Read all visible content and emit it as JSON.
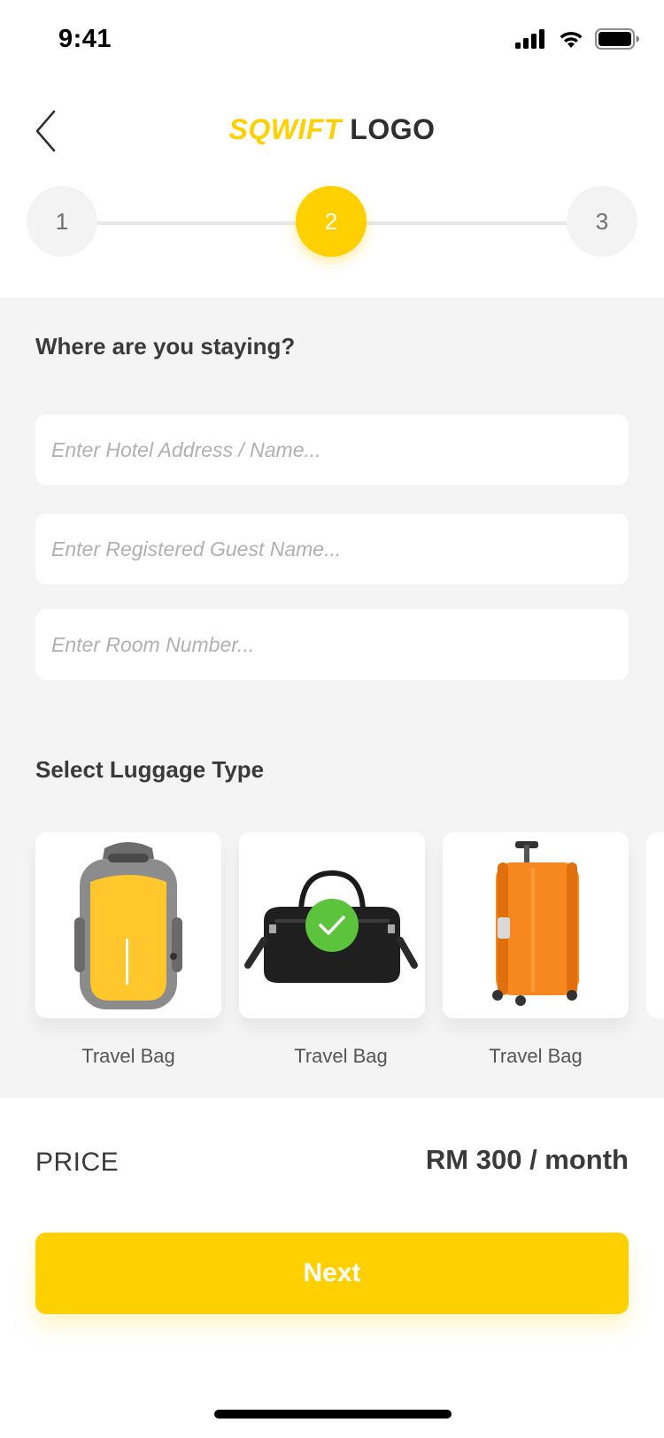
{
  "status_bar": {
    "time": "9:41"
  },
  "header": {
    "logo_part1": "SQWIFT",
    "logo_part2": "LOGO"
  },
  "stepper": {
    "steps": [
      "1",
      "2",
      "3"
    ],
    "active_index": 1
  },
  "stay_section": {
    "title": "Where are you staying?",
    "hotel_placeholder": "Enter Hotel Address / Name...",
    "guest_placeholder": "Enter Registered Guest Name...",
    "room_placeholder": "Enter Room Number..."
  },
  "luggage_section": {
    "title": "Select Luggage Type",
    "items": [
      {
        "label": "Travel Bag",
        "icon": "backpack-icon",
        "selected": false
      },
      {
        "label": "Travel Bag",
        "icon": "duffel-bag-icon",
        "selected": true
      },
      {
        "label": "Travel Bag",
        "icon": "suitcase-icon",
        "selected": false
      }
    ]
  },
  "price": {
    "label": "PRICE",
    "value": "RM 300 / month"
  },
  "next_button": {
    "label": "Next"
  },
  "colors": {
    "accent": "#FFD000",
    "check": "#5cc43c",
    "section_bg": "#f4f4f4"
  }
}
